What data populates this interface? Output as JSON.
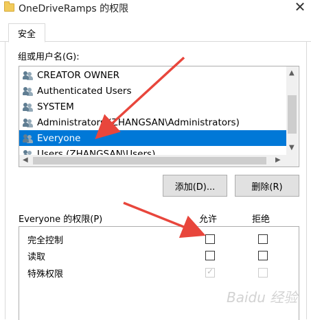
{
  "window": {
    "title": "OneDriveRamps 的权限",
    "close_glyph": "✕"
  },
  "tabs": [
    {
      "label": "安全",
      "active": true
    }
  ],
  "group_list": {
    "label": "组或用户名(G):",
    "items": [
      {
        "name": "CREATOR OWNER",
        "selected": false
      },
      {
        "name": "Authenticated Users",
        "selected": false
      },
      {
        "name": "SYSTEM",
        "selected": false
      },
      {
        "name": "Administrators (ZHANGSAN\\Administrators)",
        "selected": false
      },
      {
        "name": "Everyone",
        "selected": true
      },
      {
        "name": "Users (ZHANGSAN\\Users)",
        "selected": false
      }
    ]
  },
  "buttons": {
    "add": "添加(D)...",
    "remove": "删除(R)"
  },
  "permissions": {
    "label": "Everyone 的权限(P)",
    "allow_header": "允许",
    "deny_header": "拒绝",
    "rows": [
      {
        "name": "完全控制",
        "allow": false,
        "deny": false,
        "disabled": false
      },
      {
        "name": "读取",
        "allow": false,
        "deny": false,
        "disabled": false
      },
      {
        "name": "特殊权限",
        "allow": true,
        "deny": false,
        "disabled": true
      }
    ]
  },
  "colors": {
    "selection": "#0078d7",
    "annotation_arrow": "#e8463c"
  },
  "watermark": "Baidu 经验"
}
